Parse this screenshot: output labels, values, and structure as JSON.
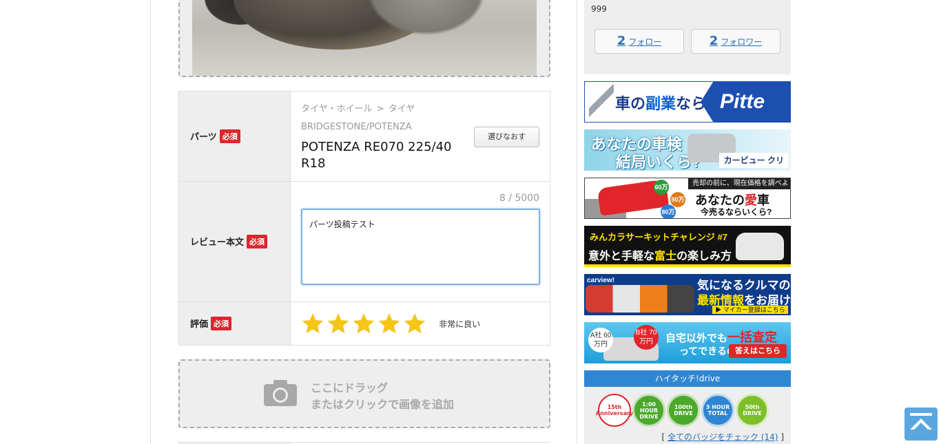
{
  "parts_row": {
    "label": "パーツ",
    "required": "必須",
    "category_parent": "タイヤ・ホイール",
    "category_sep": ">",
    "category_child": "タイヤ",
    "brand": "BRIDGESTONE/POTENZA",
    "part_name": "POTENZA RE070 225/40 R18",
    "reselect_button": "選びなおす"
  },
  "review_row": {
    "label": "レビュー本文",
    "required": "必須",
    "counter": "8 / 5000",
    "text": "パーツ投稿テスト"
  },
  "rating_row": {
    "label": "評価",
    "required": "必須",
    "stars": 5,
    "max_stars": 5,
    "rating_text": "非常に良い",
    "star_color": "#f5c518"
  },
  "image_drop": {
    "line1": "ここにドラッグ",
    "line2": "またはクリックで画像を追加"
  },
  "profile": {
    "count": "999",
    "following_num": "2",
    "following_label": "フォロー",
    "followers_num": "2",
    "followers_label": "フォロワー"
  },
  "banners": {
    "b1_text_a": "車の",
    "b1_text_b": "副業",
    "b1_text_c": "なら",
    "b1_logo": "Pitte",
    "b2_line1": "あなたの車検",
    "b2_line2": "結局いくら?",
    "b2_brand": "カービュー クリア車検",
    "b3_top": "売却の前に、現在価格を調べよう!",
    "b3_mid_a": "あなたの",
    "b3_mid_b": "愛",
    "b3_mid_c": "車",
    "b3_bot": "今売るならいくら?",
    "b3_coin1": "60万",
    "b3_coin2": "90万",
    "b3_coin3": "80万",
    "b4_line1": "みんカラサーキットチャレンジ #7",
    "b4_line2_a": "意外と手軽な",
    "b4_line2_b": "富士",
    "b4_line2_c": "の楽しみ方",
    "b5_logo": "carview!",
    "b5_line1": "気になるクルマの",
    "b5_line2_a": "最新情報",
    "b5_line2_b": "をお届け",
    "b5_cta": "▶ マイカー登録はこちら",
    "b6_c1": "A社 60万円",
    "b6_c2": "B社 70万円",
    "b6_line1_a": "自宅以外でも",
    "b6_line1_b": "一括査定",
    "b6_line2": "ってできるの?",
    "b6_cta": "答えはこちら"
  },
  "badges": {
    "title": "ハイタッチ!drive",
    "items": [
      "15th Anniversary",
      "1:00 HOUR DRIVE",
      "100th DRIVE",
      "3 HOUR TOTAL",
      "50th DRIVE"
    ],
    "link_prefix": "[",
    "link_text": "全てのバッジをチェック (14)",
    "link_suffix": "]"
  }
}
